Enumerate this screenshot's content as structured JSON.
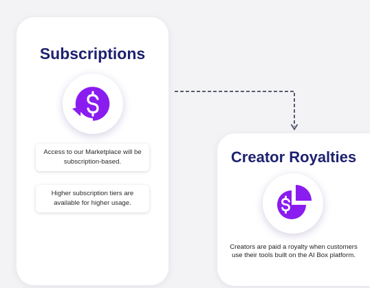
{
  "subscriptions": {
    "title": "Subscriptions",
    "icon": "dollar-refresh-icon",
    "notes": [
      "Access to our Marketplace will be subscription-based.",
      "Higher subscription tiers are available for higher usage."
    ]
  },
  "royalties": {
    "title": "Creator Royalties",
    "icon": "dollar-pie-chart-icon",
    "description": "Creators are paid a royalty when customers use their tools built on the AI Box platform."
  },
  "colors": {
    "title": "#1e2170",
    "accent": "#8a1cf0",
    "connector": "#555b6e"
  }
}
